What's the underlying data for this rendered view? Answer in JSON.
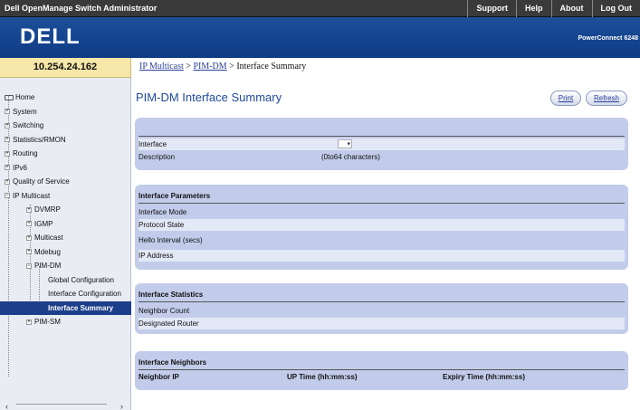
{
  "header": {
    "app_title": "Dell OpenManage Switch Administrator",
    "links": [
      "Support",
      "Help",
      "About",
      "Log Out"
    ],
    "logo": "DELL",
    "product": "PowerConnect 6248"
  },
  "ip_address": "10.254.24.162",
  "sidebar": {
    "items": [
      {
        "label": "Home",
        "icon": "home-icon"
      },
      {
        "label": "System",
        "icon": "expand-icon"
      },
      {
        "label": "Switching",
        "icon": "expand-icon"
      },
      {
        "label": "Statistics/RMON",
        "icon": "expand-icon"
      },
      {
        "label": "Routing",
        "icon": "expand-icon"
      },
      {
        "label": "IPv6",
        "icon": "expand-icon"
      },
      {
        "label": "Quality of Service",
        "icon": "expand-icon"
      },
      {
        "label": "IP Multicast",
        "icon": "collapse-icon"
      },
      {
        "label": "DVMRP",
        "icon": "expand-icon"
      },
      {
        "label": "IGMP",
        "icon": "expand-icon"
      },
      {
        "label": "Multicast",
        "icon": "expand-icon"
      },
      {
        "label": "Mdebug",
        "icon": "expand-icon"
      },
      {
        "label": "PIM-DM",
        "icon": "collapse-icon"
      },
      {
        "label": "Global Configuration",
        "icon": ""
      },
      {
        "label": "Interface Configuration",
        "icon": ""
      },
      {
        "label": "Interface Summary",
        "icon": ""
      },
      {
        "label": "PIM-SM",
        "icon": "expand-icon"
      }
    ]
  },
  "breadcrumb": {
    "link1": "IP Multicast",
    "sep1": " > ",
    "link2": "PIM-DM",
    "sep2": " > ",
    "current": "Interface Summary"
  },
  "page": {
    "title": "PIM-DM Interface Summary",
    "print_label": "Print",
    "refresh_label": "Refresh"
  },
  "interface_panel": {
    "interface_label": "Interface",
    "description_label": "Description",
    "description_hint": "(0to64 characters)"
  },
  "params_panel": {
    "heading": "Interface Parameters",
    "rows": [
      "Interface Mode",
      "Protocol State",
      "Hello Interval (secs)",
      "IP Address"
    ]
  },
  "stats_panel": {
    "heading": "Interface Statistics",
    "rows": [
      "Neighbor Count",
      "Designated Router"
    ]
  },
  "neighbors_panel": {
    "heading": "Interface Neighbors",
    "columns": [
      "Neighbor IP",
      "UP Time (hh:mm:ss)",
      "Expiry Time (hh:mm:ss)"
    ]
  },
  "colors": {
    "topbar": "#3a3a3a",
    "brand": "#1c4f9a",
    "panel": "#c2ccea",
    "title": "#1f4a9a",
    "active_nav": "#1d3f8a",
    "ip_box": "#f6e6a8"
  }
}
